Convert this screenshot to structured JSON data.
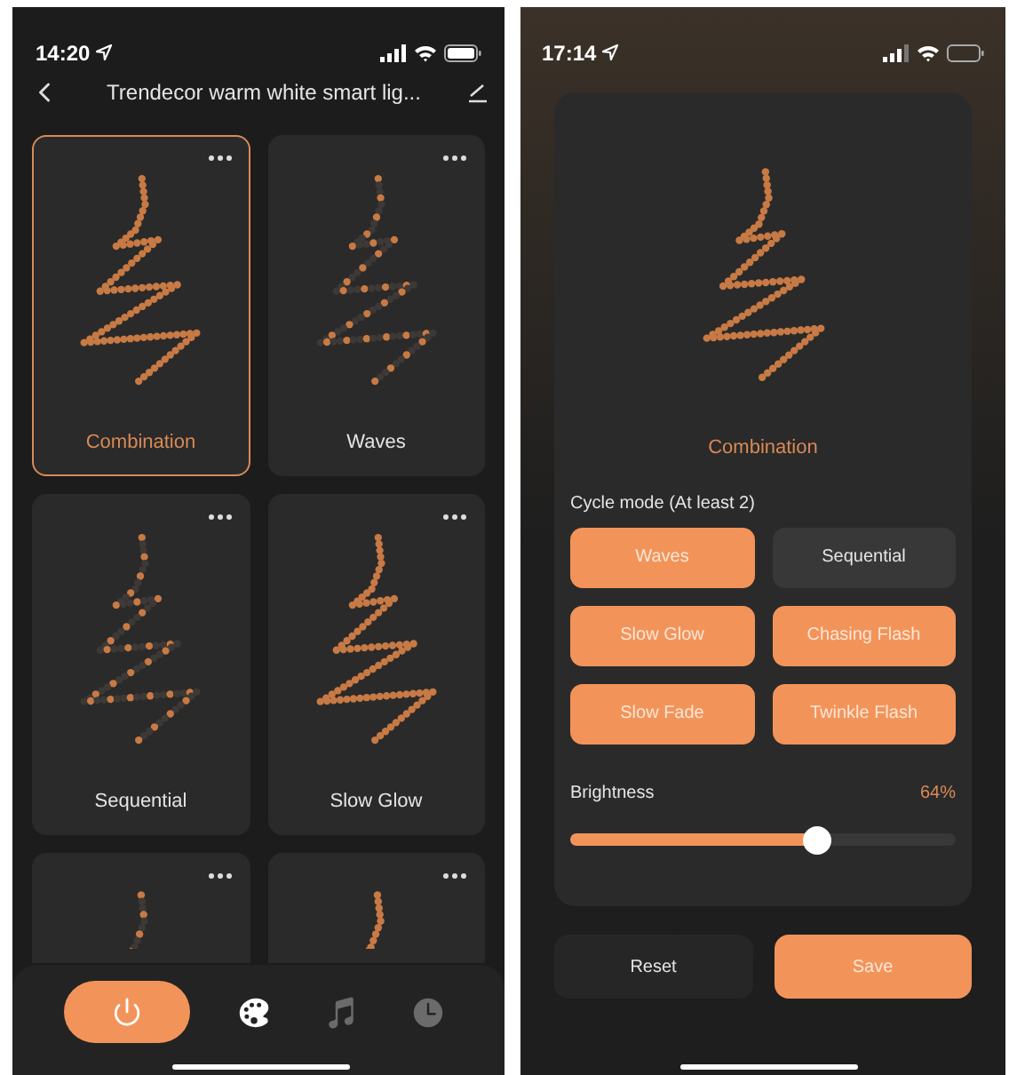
{
  "left": {
    "status": {
      "time": "14:20"
    },
    "title": "Trendecor warm white smart lig...",
    "effects": [
      {
        "name": "Combination",
        "kind": "full",
        "selected": true
      },
      {
        "name": "Waves",
        "kind": "partial",
        "selected": false
      },
      {
        "name": "Sequential",
        "kind": "partial",
        "selected": false
      },
      {
        "name": "Slow Glow",
        "kind": "full",
        "selected": false
      },
      {
        "kind": "partial",
        "selected": false
      },
      {
        "kind": "full",
        "selected": false
      }
    ],
    "power": {
      "on": true
    },
    "tabs": [
      {
        "kind": "palette",
        "selected": true
      },
      {
        "kind": "music",
        "selected": false
      },
      {
        "kind": "timer",
        "selected": false
      }
    ]
  },
  "right": {
    "status": {
      "time": "17:14"
    },
    "effect": {
      "name": "Combination",
      "kind": "full"
    },
    "cycle_label": "Cycle mode (At least 2)",
    "modes": [
      {
        "label": "Waves",
        "selected": true
      },
      {
        "label": "Sequential",
        "selected": false
      },
      {
        "label": "Slow Glow",
        "selected": true
      },
      {
        "label": "Chasing Flash",
        "selected": true
      },
      {
        "label": "Slow Fade",
        "selected": true
      },
      {
        "label": "Twinkle Flash",
        "selected": true
      }
    ],
    "brightness": {
      "label": "Brightness",
      "reading": "64%",
      "level": 0.64
    },
    "buttons": [
      {
        "label": "Reset",
        "kind": "secondary"
      },
      {
        "label": "Save",
        "kind": "primary"
      }
    ]
  }
}
